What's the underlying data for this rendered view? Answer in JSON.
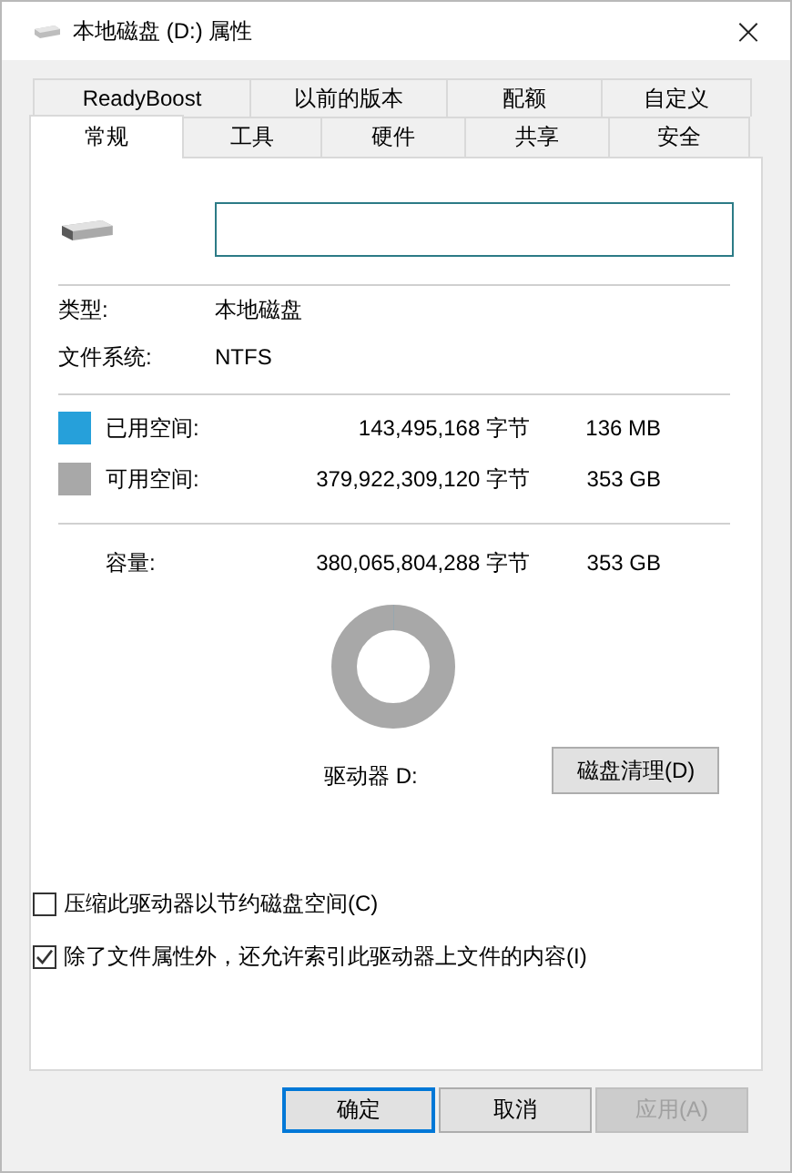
{
  "window": {
    "title": "本地磁盘 (D:) 属性",
    "close": "×"
  },
  "tab_rows": [
    [
      {
        "label": "ReadyBoost",
        "selected": false
      },
      {
        "label": "以前的版本",
        "selected": false
      },
      {
        "label": "配额",
        "selected": false
      },
      {
        "label": "自定义",
        "selected": false
      }
    ],
    [
      {
        "label": "常规",
        "selected": true
      },
      {
        "label": "工具",
        "selected": false
      },
      {
        "label": "硬件",
        "selected": false
      },
      {
        "label": "共享",
        "selected": false
      },
      {
        "label": "安全",
        "selected": false
      }
    ]
  ],
  "info": [
    {
      "label": "类型:",
      "value": "本地磁盘"
    },
    {
      "label": "文件系统:",
      "value": "NTFS"
    }
  ],
  "space": [
    {
      "label": "已用空间:",
      "bytes": "143,495,168 字节",
      "size": "136 MB",
      "color": "#26a0da"
    },
    {
      "label": "可用空间:",
      "bytes": "379,922,309,120 字节",
      "size": "353 GB",
      "color": "#a8a8a8"
    }
  ],
  "capacity": {
    "label": "容量:",
    "bytes": "380,065,804,288 字节",
    "size": "353 GB"
  },
  "donut": {
    "level": 0.0004
  },
  "drive_label": "驱动器 D:",
  "cleanup_button": "磁盘清理(D)",
  "options": [
    {
      "label": "压缩此驱动器以节约磁盘空间(C)",
      "checked": false
    },
    {
      "label": "除了文件属性外，还允许索引此驱动器上文件的内容(I)",
      "checked": true
    }
  ],
  "buttons": [
    {
      "label": "确定",
      "default": true,
      "disabled": false
    },
    {
      "label": "取消",
      "default": false,
      "disabled": false
    },
    {
      "label": "应用(A)",
      "default": false,
      "disabled": true
    }
  ]
}
